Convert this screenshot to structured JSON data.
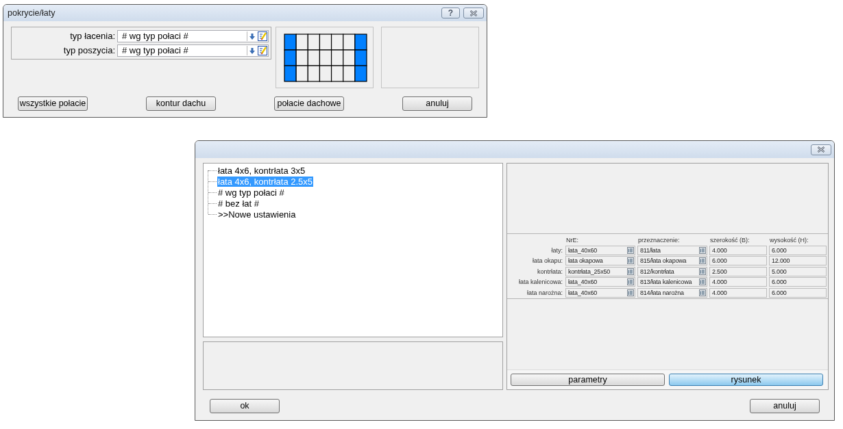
{
  "window_top": {
    "title": "pokrycie/łaty",
    "help_button": "?",
    "fields": [
      {
        "label": "typ łacenia:",
        "value": "# wg typ połaci #"
      },
      {
        "label": "typ poszycia:",
        "value": "# wg typ połaci #"
      }
    ],
    "roof_grid": {
      "rows": [
        {
          "cells": [
            {
              "selected": true
            },
            {
              "selected": false
            },
            {
              "selected": false
            },
            {
              "selected": false
            },
            {
              "selected": false
            },
            {
              "selected": false
            },
            {
              "selected": true
            }
          ]
        },
        {
          "cells": [
            {
              "selected": true
            },
            {
              "selected": false
            },
            {
              "selected": false
            },
            {
              "selected": false
            },
            {
              "selected": false
            },
            {
              "selected": false
            },
            {
              "selected": true
            }
          ]
        },
        {
          "cells": [
            {
              "selected": true
            },
            {
              "selected": false
            },
            {
              "selected": false
            },
            {
              "selected": false
            },
            {
              "selected": false
            },
            {
              "selected": false
            },
            {
              "selected": true
            }
          ]
        }
      ]
    },
    "buttons": [
      {
        "label": "wszystkie połacie"
      },
      {
        "label": "kontur dachu"
      },
      {
        "label": "połacie dachowe"
      },
      {
        "label": "anuluj"
      }
    ]
  },
  "window_bottom": {
    "tree": {
      "items": [
        {
          "label": "łata 4x6, kontrłata 3x5",
          "selected": false
        },
        {
          "label": "łata 4x6, kontrłata 2.5x5",
          "selected": true
        },
        {
          "label": "# wg typ połaci #",
          "selected": false
        },
        {
          "label": "# bez łat #",
          "selected": false
        },
        {
          "label": ">>Nowe ustawienia",
          "selected": false
        }
      ]
    },
    "table": {
      "columns": [
        {
          "label": "NrE:",
          "kind": "lookup"
        },
        {
          "label": "przeznaczenie:",
          "kind": "lookup"
        },
        {
          "label": "szerokość (B):",
          "kind": "number"
        },
        {
          "label": "wysokość (H):",
          "kind": "number"
        }
      ],
      "rows": [
        {
          "label": "łaty:",
          "cells": [
            "łata_40x60",
            "811/łata",
            "4.000",
            "6.000"
          ]
        },
        {
          "label": "łata okapu:",
          "cells": [
            "łata okapowa",
            "815/łata okapowa",
            "6.000",
            "12.000"
          ]
        },
        {
          "label": "kontrłata:",
          "cells": [
            "kontrłata_25x50",
            "812/kontrłata",
            "2.500",
            "5.000"
          ]
        },
        {
          "label": "łata kalenicowa:",
          "cells": [
            "łata_40x60",
            "813/łata kalenicowa",
            "4.000",
            "6.000"
          ]
        },
        {
          "label": "łata narożna:",
          "cells": [
            "łata_40x60",
            "814/łata narożna",
            "4.000",
            "6.000"
          ]
        }
      ]
    },
    "view_buttons": [
      {
        "label": "parametry",
        "selected": false
      },
      {
        "label": "rysunek",
        "selected": true
      }
    ],
    "buttons": [
      {
        "label": "ok"
      },
      {
        "label": "anuluj"
      }
    ]
  }
}
